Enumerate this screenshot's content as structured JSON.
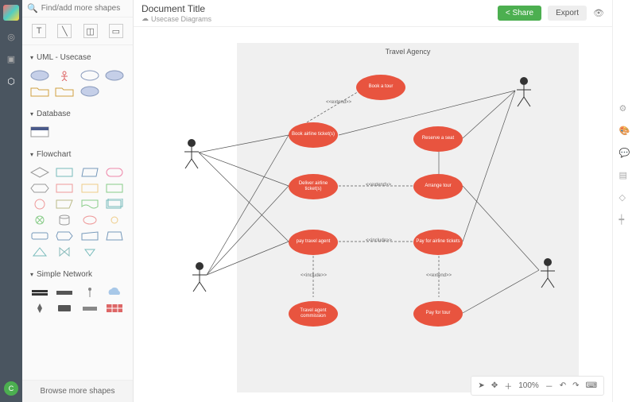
{
  "search": {
    "placeholder": "Find/add more shapes"
  },
  "tools": {
    "text": "T",
    "line": "╲",
    "page": "◫",
    "rect": "▭"
  },
  "sections": {
    "uml": {
      "title": "UML - Usecase"
    },
    "database": {
      "title": "Database"
    },
    "flowchart": {
      "title": "Flowchart"
    },
    "network": {
      "title": "Simple Network"
    }
  },
  "browse_more": "Browse more shapes",
  "document": {
    "title": "Document Title",
    "subtitle": "Usecase Diagrams"
  },
  "buttons": {
    "share": "Share",
    "export": "Export"
  },
  "diagram": {
    "title": "Travel Agency",
    "nodes": {
      "book_tour": "Book a tour",
      "book_airline": "Book airline ticket(s)",
      "reserve_seat": "Reserve a seat",
      "deliver": "Deliver airline ticket(s)",
      "arrange": "Arrange tour",
      "pay_agent": "pay travel agent",
      "pay_airline": "Pay for airline tickets",
      "commission": "Travel agent commission",
      "pay_tour": "Pay for tour"
    },
    "labels": {
      "extend1": "<<extend>>",
      "extend2": "<<extend>>",
      "extend3": "<<extend>>",
      "include1": "<<include>>",
      "include2": "<<include>>"
    }
  },
  "zoom": {
    "level": "100%"
  },
  "rail_avatar": "C"
}
